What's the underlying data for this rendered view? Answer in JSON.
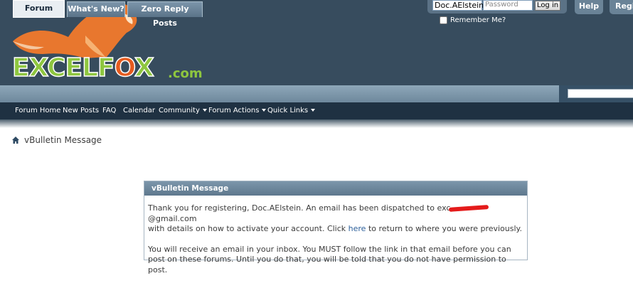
{
  "header": {
    "logo": {
      "text_main": "EXCELF",
      "text_o": "O",
      "text_end": "X",
      "domain": ".com"
    },
    "login": {
      "username_value": "Doc.AElstein",
      "password_placeholder": "Password",
      "login_button": "Log in",
      "remember_label": "Remember Me?"
    },
    "buttons": {
      "help": "Help",
      "register": "Register"
    }
  },
  "tabs": [
    {
      "label": "Forum",
      "active": true
    },
    {
      "label": "What's New?",
      "active": false
    },
    {
      "label": "Zero Reply Posts",
      "active": false
    }
  ],
  "nav": {
    "items": [
      {
        "label": "Forum Home",
        "dropdown": false
      },
      {
        "label": "New Posts",
        "dropdown": false
      },
      {
        "label": "FAQ",
        "dropdown": false
      },
      {
        "label": "Calendar",
        "dropdown": false
      },
      {
        "label": "Community",
        "dropdown": true
      },
      {
        "label": "Forum Actions",
        "dropdown": true
      },
      {
        "label": "Quick Links",
        "dropdown": true
      }
    ]
  },
  "breadcrumb": {
    "current": "vBulletin Message",
    "icon": "home-icon"
  },
  "message": {
    "title": "vBulletin Message",
    "para1_before_email": "Thank you for registering, Doc.AElstein. An email has been dispatched to exc",
    "para1_email_end": "@gmail.com",
    "para1_line2_before_link": "with details on how to activate your account. Click ",
    "para1_link": "here",
    "para1_after_link": " to return to where you were previously.",
    "para2": "You will receive an email in your inbox. You MUST follow the link in that email before you can post on these forums. Until you do that, you will be told that you do not have permission to post."
  },
  "colors": {
    "header_bg": "#374c5e",
    "navbar_bg": "#1f3142",
    "logo_green": "#8ec63f",
    "logo_orange": "#e55b1f",
    "redaction": "#e41b1b"
  }
}
